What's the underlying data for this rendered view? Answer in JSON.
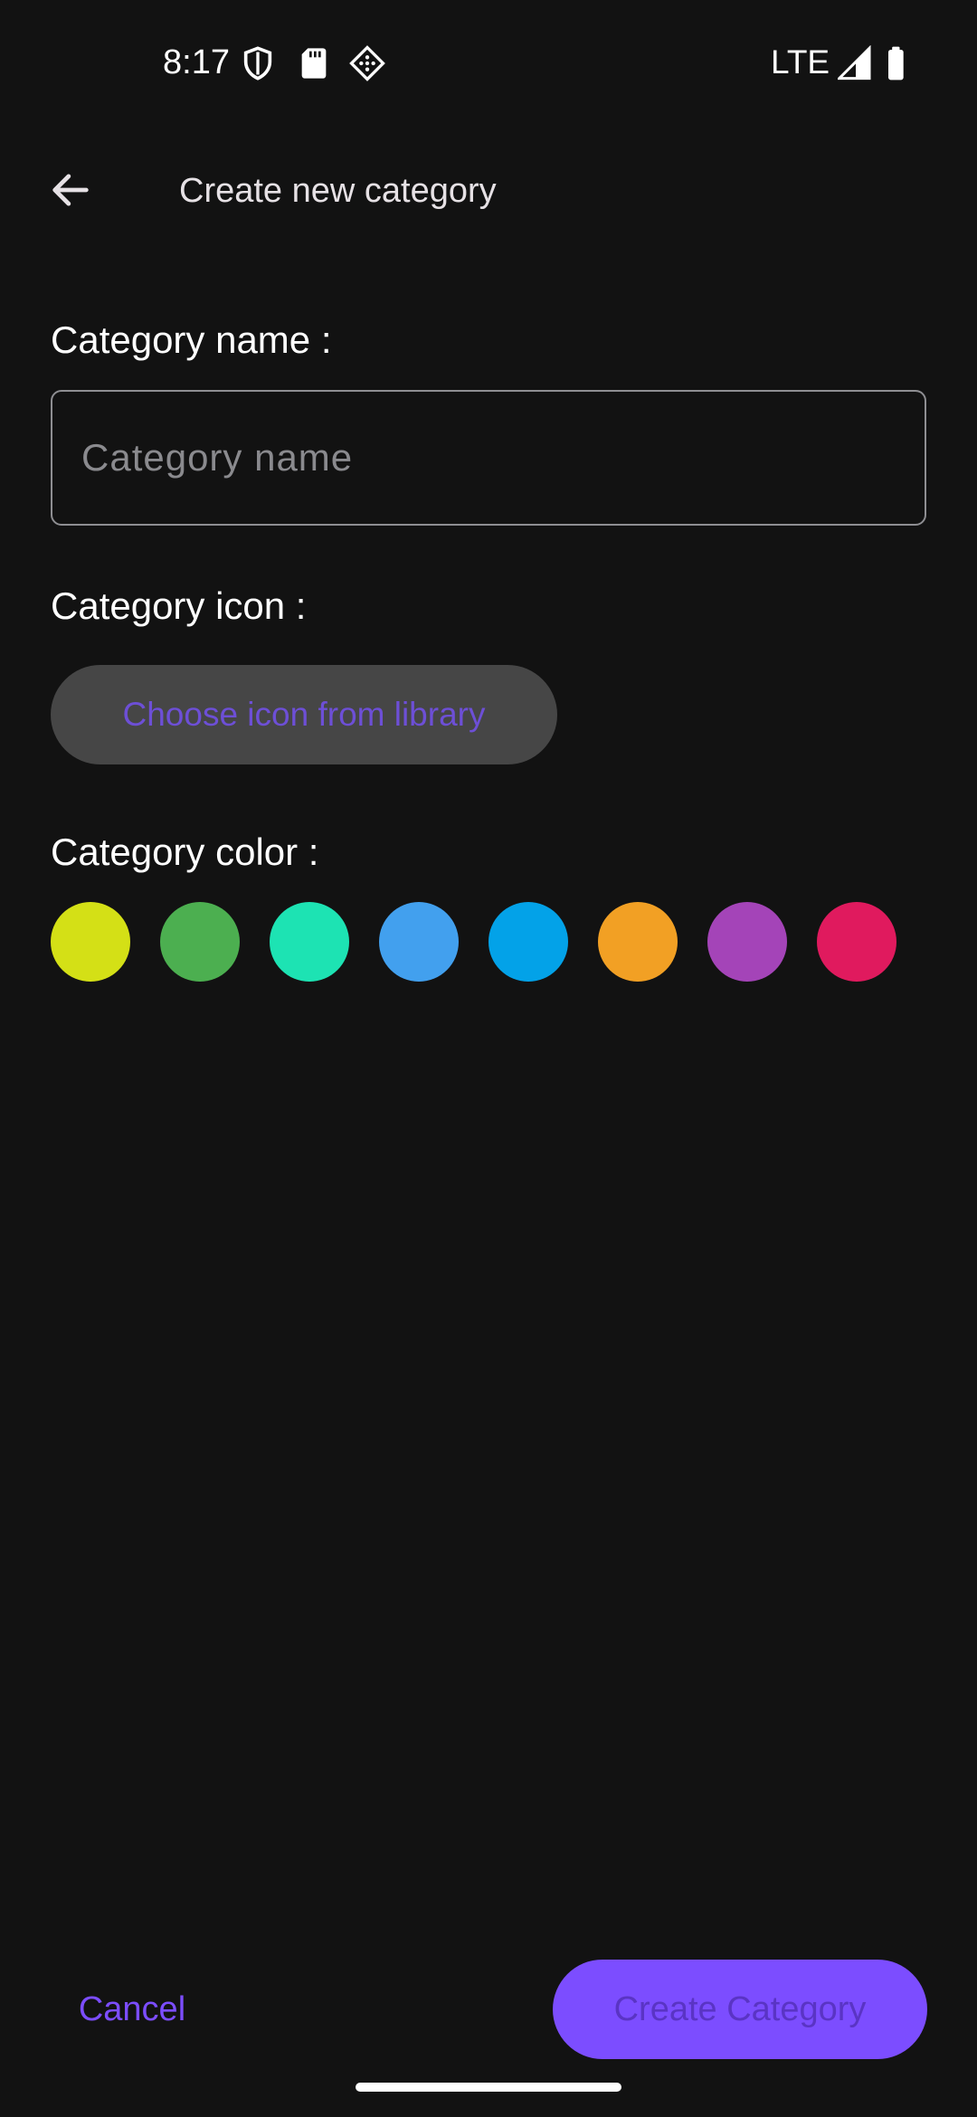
{
  "status_bar": {
    "time": "8:17",
    "network": "LTE",
    "icons": [
      "shield-icon",
      "sd-card-icon",
      "diamond-grid-icon",
      "signal-icon",
      "battery-icon"
    ]
  },
  "app_bar": {
    "back_icon": "arrow-back-icon",
    "title": "Create new category"
  },
  "form": {
    "name_label": "Category name :",
    "name_input": {
      "value": "",
      "placeholder": "Category name"
    },
    "icon_label": "Category icon :",
    "icon_button_label": "Choose icon from library",
    "color_label": "Category color :",
    "colors": [
      "#d4e016",
      "#4caf50",
      "#1de3b3",
      "#42a0ee",
      "#03a2e8",
      "#f2a024",
      "#a444b8",
      "#e01a5e"
    ]
  },
  "actions": {
    "cancel_label": "Cancel",
    "create_label": "Create Category"
  },
  "theme": {
    "background": "#121212",
    "accent": "#7c4dff"
  }
}
